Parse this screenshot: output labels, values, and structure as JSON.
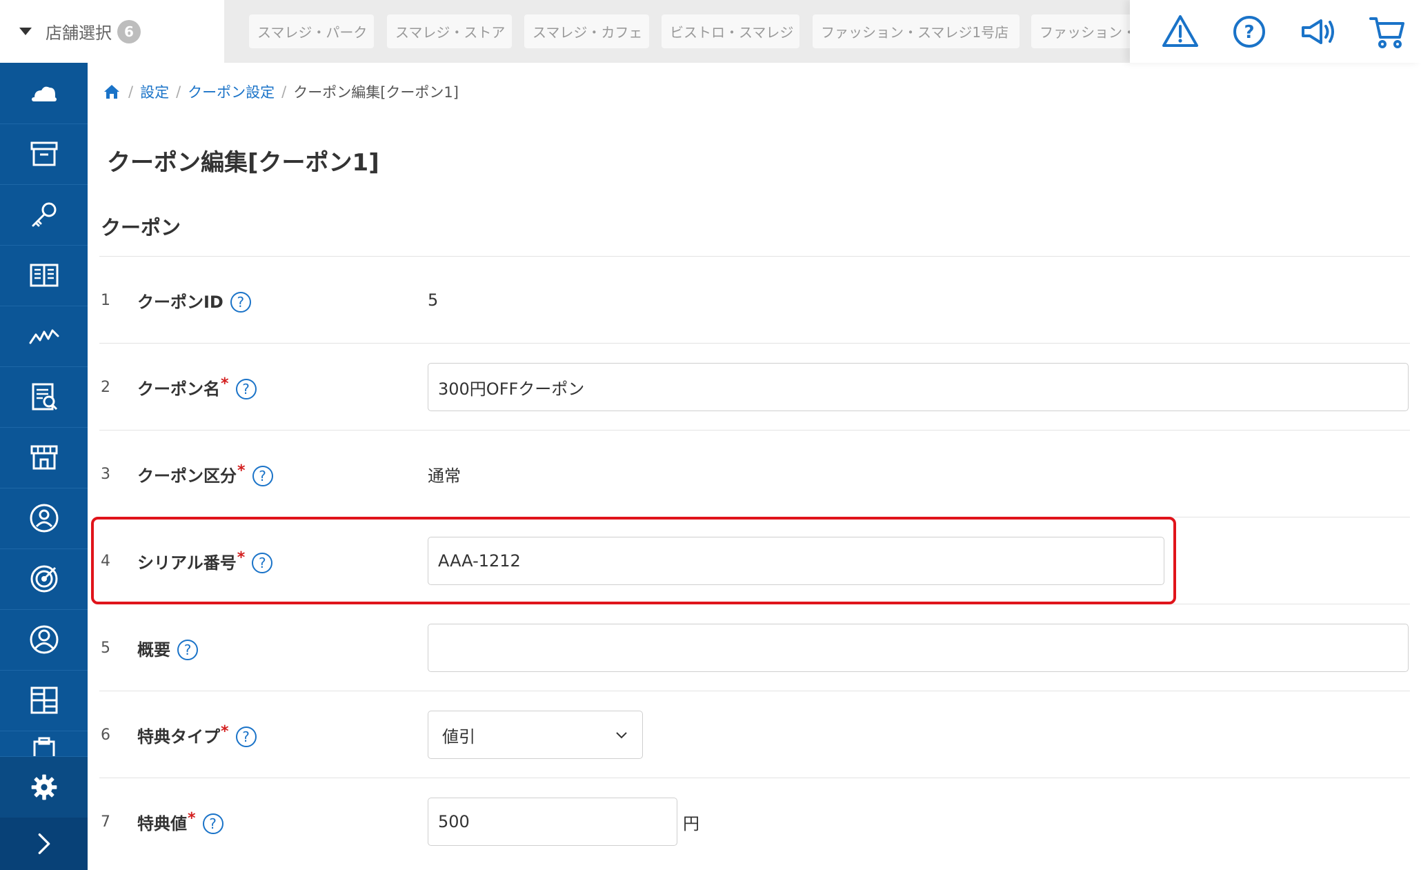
{
  "topbar": {
    "store_select_label": "店舗選択",
    "store_count": "6",
    "store_tabs": [
      "スマレジ・パーク",
      "スマレジ・ストア",
      "スマレジ・カフェ",
      "ビストロ・スマレジ",
      "ファッション・スマレジ1号店",
      "ファッション・"
    ],
    "icons": [
      "warning-icon",
      "help-icon",
      "megaphone-icon",
      "cart-icon"
    ]
  },
  "sidebar": {
    "items": [
      "cloud-icon",
      "archive-box-icon",
      "key-icon",
      "book-icon",
      "chart-line-icon",
      "report-icon",
      "store-icon",
      "customer-icon",
      "target-icon",
      "user-icon",
      "grid-icon",
      "clipboard-icon"
    ],
    "settings": "gear-icon",
    "expand": "chevron-right-icon"
  },
  "breadcrumb": {
    "home": "home-icon",
    "settings": "設定",
    "coupon_settings": "クーポン設定",
    "current": "クーポン編集[クーポン1]"
  },
  "page_title": "クーポン編集[クーポン1]",
  "section_title": "クーポン",
  "fields": {
    "f1": {
      "num": "1",
      "label": "クーポンID",
      "value": "5"
    },
    "f2": {
      "num": "2",
      "label": "クーポン名",
      "value": "300円OFFクーポン"
    },
    "f3": {
      "num": "3",
      "label": "クーポン区分",
      "value": "通常"
    },
    "f4": {
      "num": "4",
      "label": "シリアル番号",
      "value": "AAA-1212"
    },
    "f5": {
      "num": "5",
      "label": "概要",
      "value": ""
    },
    "f6": {
      "num": "6",
      "label": "特典タイプ",
      "value": "値引"
    },
    "f7": {
      "num": "7",
      "label": "特典値",
      "value": "500",
      "unit": "円"
    }
  },
  "required_mark": "*",
  "help_mark": "?",
  "colors": {
    "sidebar": "#0c5697",
    "accent": "#1a73c8",
    "highlight": "#e0141b",
    "required": "#d31f1f"
  }
}
